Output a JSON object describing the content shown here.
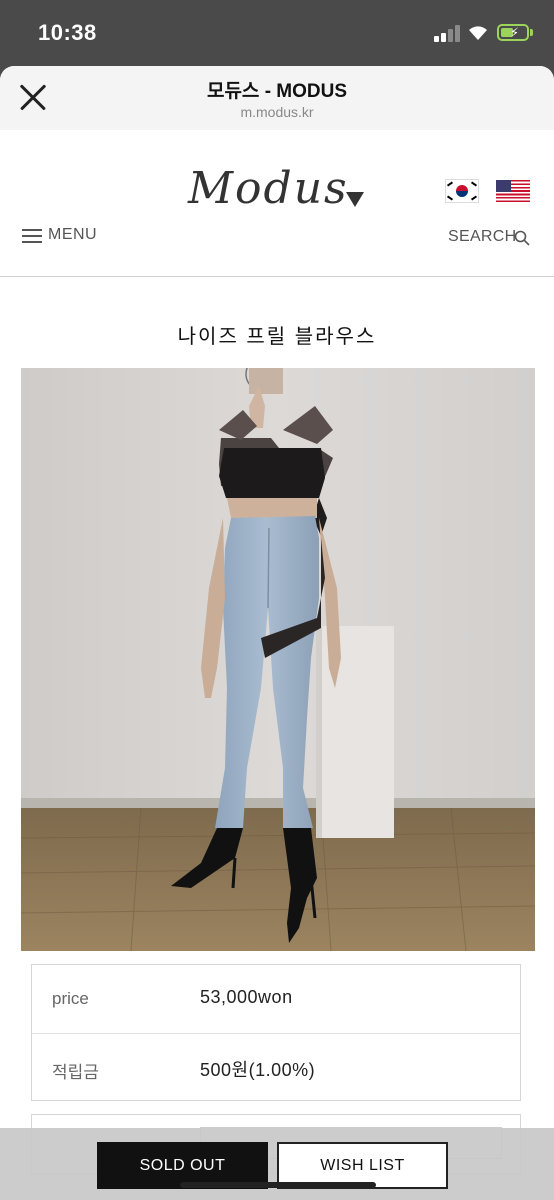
{
  "status_bar": {
    "time": "10:38"
  },
  "browser": {
    "title": "모듀스 - MODUS",
    "url": "m.modus.kr"
  },
  "site": {
    "logo": "Modus",
    "menu_label": "MENU",
    "search_label": "SEARCH"
  },
  "product": {
    "name": "나이즈 프릴 블라우스",
    "price_label": "price",
    "price_value": "53,000won",
    "points_label": "적립금",
    "points_value": "500원(1.00%)"
  },
  "actions": {
    "sold_out": "SOLD OUT",
    "wish_list": "WISH LIST"
  },
  "colors": {
    "sold_out_bg": "#111111",
    "battery": "#9bd35b",
    "flag_red": "#c8102e",
    "flag_blue": "#003478"
  }
}
